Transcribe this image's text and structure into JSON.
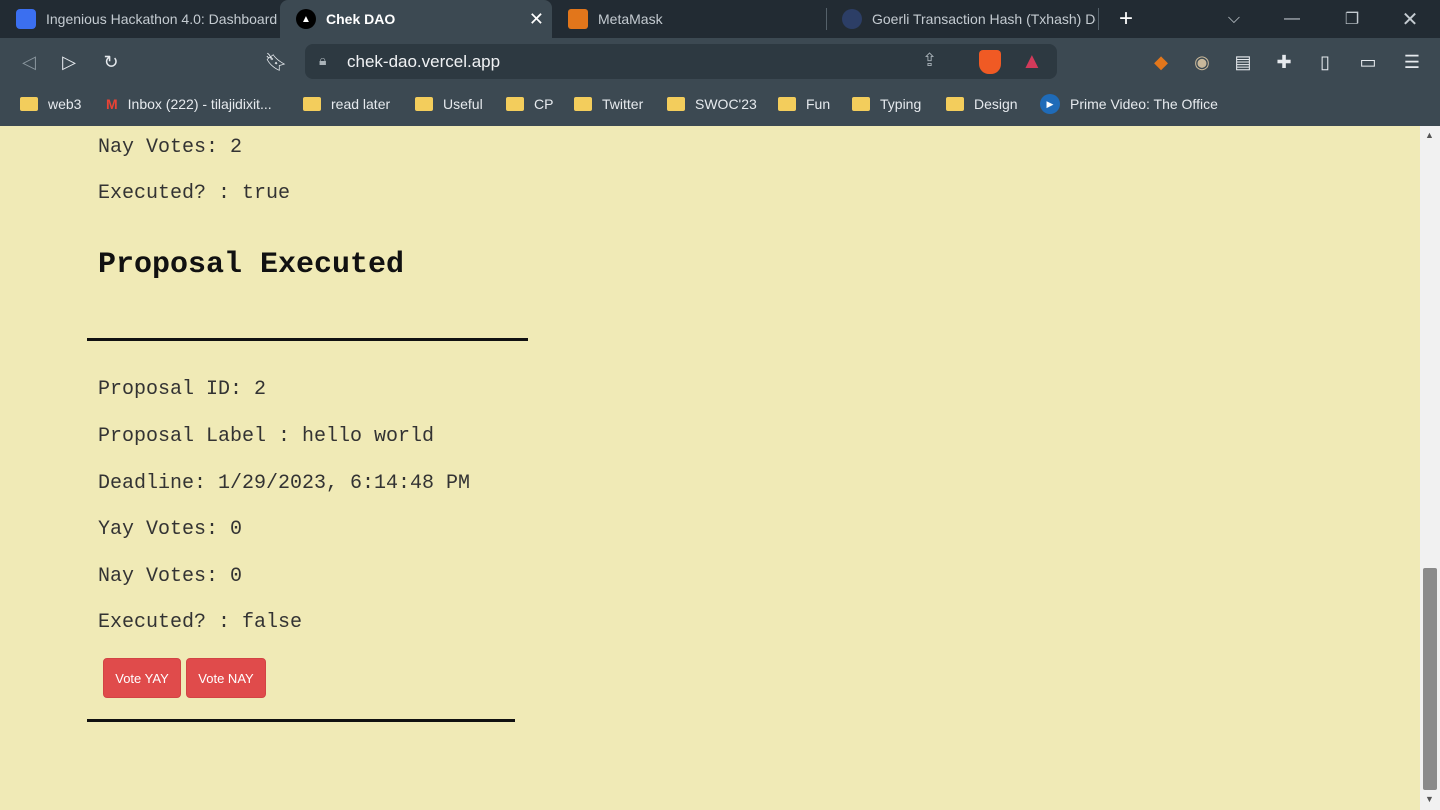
{
  "browser": {
    "tabs": [
      {
        "label": "Ingenious Hackathon 4.0: Dashboard",
        "active": false
      },
      {
        "label": "Chek DAO",
        "active": true
      },
      {
        "label": "MetaMask",
        "active": false
      },
      {
        "label": "Goerli Transaction Hash (Txhash) Details",
        "active": false
      }
    ],
    "url": "chek-dao.vercel.app",
    "bookmarks": [
      "web3",
      "Inbox (222) - tilajidixit...",
      "read later",
      "Useful",
      "CP",
      "Twitter",
      "SWOC'23",
      "Fun",
      "Typing",
      "Design",
      "Prime Video: The Office"
    ]
  },
  "proposals": [
    {
      "nay": "Nay Votes: 2",
      "executed": "Executed? : true",
      "status": "Proposal Executed"
    },
    {
      "id": "Proposal ID: 2",
      "label": "Proposal Label : hello world",
      "deadline": "Deadline: 1/29/2023, 6:14:48 PM",
      "yay": "Yay Votes: 0",
      "nay": "Nay Votes: 0",
      "executed": "Executed? : false",
      "vote_yay": "Vote YAY",
      "vote_nay": "Vote NAY"
    }
  ],
  "colors": {
    "page_bg": "#f0eab6",
    "button": "#e04b4b"
  }
}
